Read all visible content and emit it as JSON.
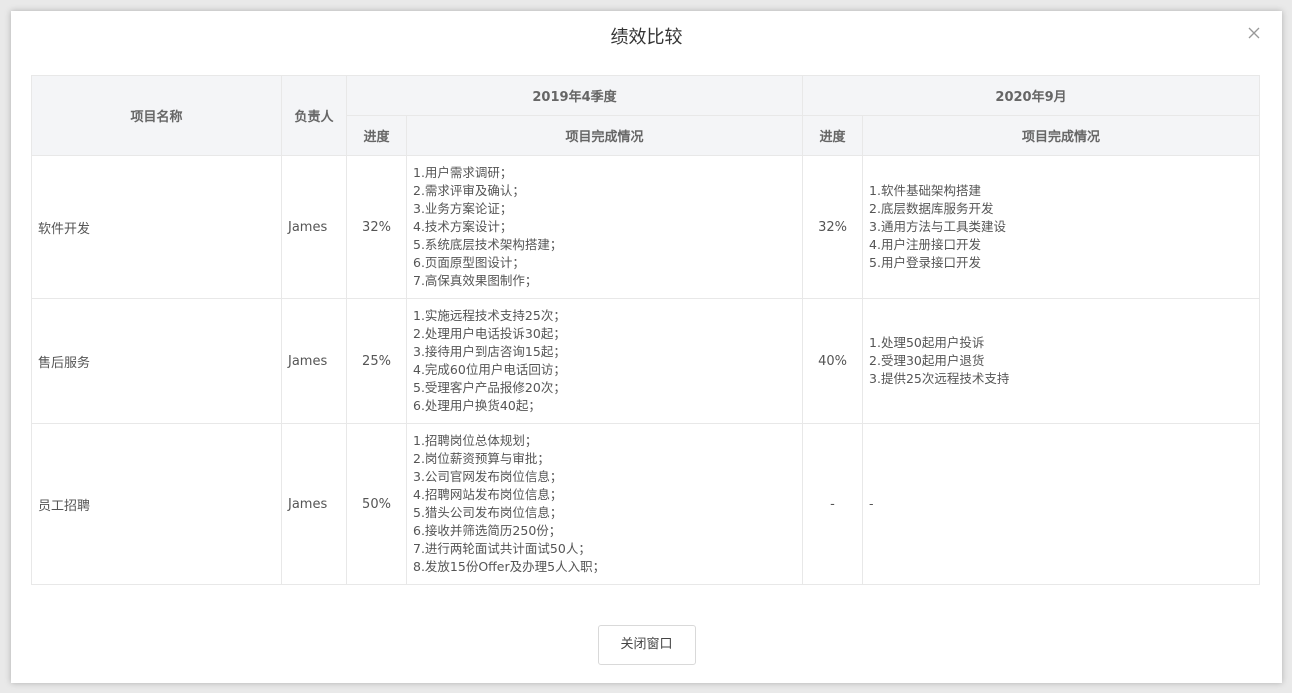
{
  "dialog": {
    "title": "绩效比较",
    "close_button_label": "关闭窗口"
  },
  "table": {
    "headers": {
      "project_name": "项目名称",
      "owner": "负责人",
      "period1": "2019年4季度",
      "period2": "2020年9月",
      "progress": "进度",
      "completion": "项目完成情况"
    },
    "rows": [
      {
        "name": "软件开发",
        "owner": "James",
        "p1_progress": "32%",
        "p1_items": [
          "1.用户需求调研；",
          "2.需求评审及确认；",
          "3.业务方案论证；",
          "4.技术方案设计；",
          "5.系统底层技术架构搭建；",
          "6.页面原型图设计；",
          "7.高保真效果图制作；"
        ],
        "p2_progress": "32%",
        "p2_items": [
          "1.软件基础架构搭建",
          "2.底层数据库服务开发",
          "3.通用方法与工具类建设",
          "4.用户注册接口开发",
          "5.用户登录接口开发"
        ]
      },
      {
        "name": "售后服务",
        "owner": "James",
        "p1_progress": "25%",
        "p1_items": [
          "1.实施远程技术支持25次；",
          "2.处理用户电话投诉30起；",
          "3.接待用户到店咨询15起；",
          "4.完成60位用户电话回访；",
          "5.受理客户产品报修20次；",
          "6.处理用户换货40起；"
        ],
        "p2_progress": "40%",
        "p2_items": [
          "1.处理50起用户投诉",
          "2.受理30起用户退货",
          "3.提供25次远程技术支持"
        ]
      },
      {
        "name": "员工招聘",
        "owner": "James",
        "p1_progress": "50%",
        "p1_items": [
          "1.招聘岗位总体规划；",
          "2.岗位薪资预算与审批；",
          "3.公司官网发布岗位信息；",
          "4.招聘网站发布岗位信息；",
          "5.猎头公司发布岗位信息；",
          "6.接收并筛选简历250份；",
          "7.进行两轮面试共计面试50人；",
          "8.发放15份Offer及办理5人入职；"
        ],
        "p2_progress": "-",
        "p2_items": [
          "-"
        ]
      }
    ]
  }
}
